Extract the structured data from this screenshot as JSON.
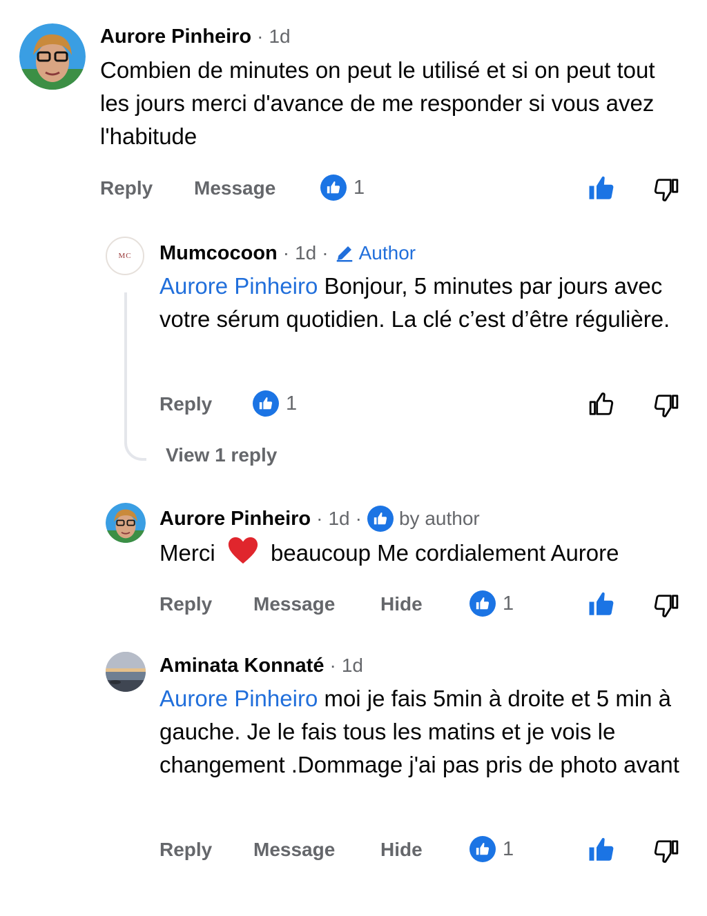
{
  "comments": [
    {
      "author": "Aurore Pinheiro",
      "time": "1d",
      "mention": "",
      "text": "Combien de minutes on peut le utilisé et si on peut tout les jours merci d'avance de me responder si vous avez l'habitude",
      "actions": {
        "reply": "Reply",
        "message": "Message"
      },
      "reaction_count": "1",
      "liked": true
    },
    {
      "author": "Mumcocoon",
      "time": "1d",
      "badge": "Author",
      "avatar_initials": "MC",
      "mention": "Aurore Pinheiro",
      "text": "Bonjour, 5 minutes par jours avec votre sérum quotidien. La clé c’est d’être régulière.",
      "actions": {
        "reply": "Reply"
      },
      "reaction_count": "1",
      "liked": false,
      "view_replies": "View 1 reply"
    },
    {
      "author": "Aurore Pinheiro",
      "time": "1d",
      "badge": "by author",
      "text_before": "Merci",
      "emoji": "❤️",
      "text_after": "beaucoup Me cordialement Aurore",
      "actions": {
        "reply": "Reply",
        "message": "Message",
        "hide": "Hide"
      },
      "reaction_count": "1",
      "liked": true
    },
    {
      "author": "Aminata Konnaté",
      "time": "1d",
      "mention": "Aurore Pinheiro",
      "text": "moi je fais 5min à droite et 5 min à gauche. Je le fais tous les matins et je vois le changement .Dommage j'ai pas pris de photo avant",
      "actions": {
        "reply": "Reply",
        "message": "Message",
        "hide": "Hide"
      },
      "reaction_count": "1",
      "liked": true
    }
  ],
  "separator": "·",
  "colors": {
    "accent": "#1b74e4",
    "mention": "#216fdb",
    "muted": "#65676b"
  },
  "icons": [
    "like-badge-icon",
    "thumbs-up-icon",
    "thumbs-down-icon",
    "pencil-icon"
  ]
}
